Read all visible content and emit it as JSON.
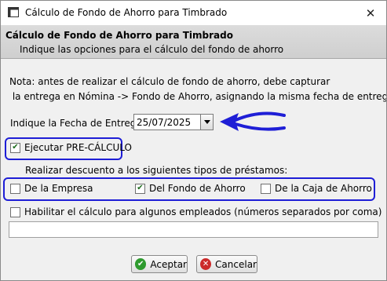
{
  "window": {
    "title": "Cálculo de Fondo de Ahorro para Timbrado",
    "close_glyph": "✕"
  },
  "header": {
    "title": "Cálculo de Fondo de Ahorro para Timbrado",
    "subtitle": "Indique las opciones para el cálculo del fondo de ahorro"
  },
  "note": {
    "line1": "Nota: antes de realizar el cálculo de fondo de ahorro, debe capturar",
    "line2": " la entrega en Nómina -> Fondo de Ahorro, asignando la misma fecha de entrega"
  },
  "date": {
    "label": "Indique la Fecha de Entrega",
    "value": "25/07/2025",
    "dropdown_icon": "triangle-down-icon"
  },
  "precalculo": {
    "label": "Ejecutar PRE-CÁLCULO",
    "checked": true
  },
  "loans": {
    "label": "Realizar descuento a los siguientes tipos de préstamos:",
    "options": [
      {
        "label": "De la Empresa",
        "checked": false
      },
      {
        "label": "Del Fondo de Ahorro",
        "checked": true
      },
      {
        "label": "De la Caja de Ahorro",
        "checked": false
      }
    ]
  },
  "employees": {
    "label": "Habilitar el cálculo para algunos empleados (números separados por coma)",
    "checked": false,
    "value": ""
  },
  "buttons": {
    "accept": "Aceptar",
    "cancel": "Cancelar"
  },
  "colors": {
    "annotation": "#1e1ed6",
    "accept_icon": "#2e9a2e",
    "cancel_icon": "#cc2a2a"
  }
}
